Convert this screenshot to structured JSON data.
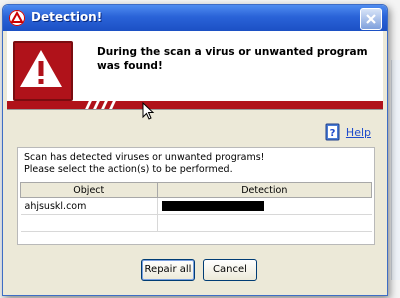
{
  "window": {
    "title": "Detection!"
  },
  "header": {
    "message": "During the scan a virus or unwanted program was found!"
  },
  "help": {
    "label": "Help"
  },
  "content": {
    "message_line1": "Scan has detected viruses or unwanted programs!",
    "message_line2": "Please select the action(s) to be performed.",
    "columns": [
      "Object",
      "Detection"
    ],
    "rows": [
      {
        "object": "ahjsuskl.com",
        "detection": ""
      }
    ]
  },
  "buttons": {
    "repair_all": "Repair all",
    "cancel": "Cancel"
  },
  "icons": {
    "app": "avira-umbrella-icon",
    "warning": "warning-triangle-icon",
    "help": "help-book-icon",
    "close": "close-icon",
    "cursor": "mouse-pointer-icon"
  },
  "colors": {
    "titlebar": "#2a63d8",
    "accent_red": "#b0121a",
    "link": "#1f4ccc"
  }
}
